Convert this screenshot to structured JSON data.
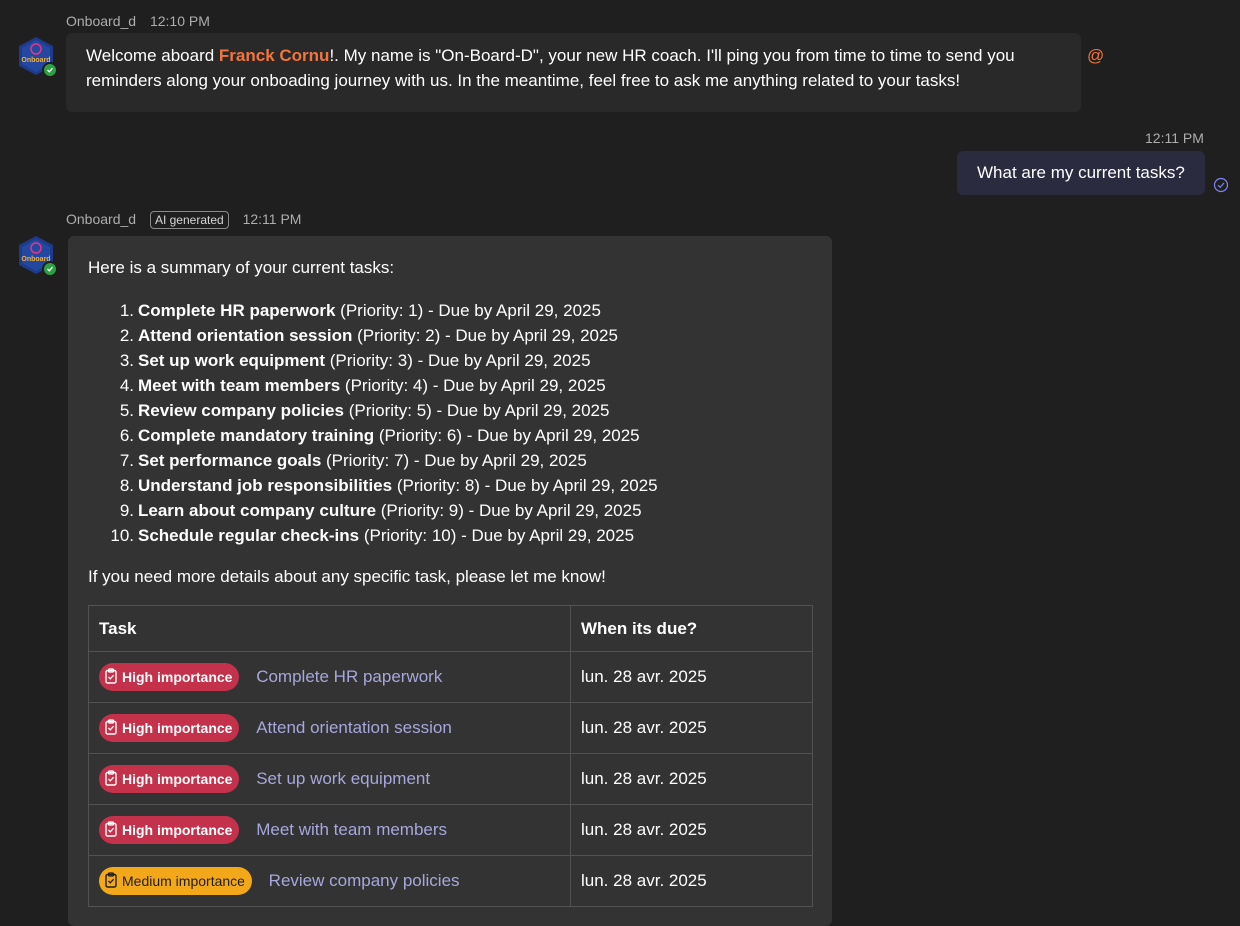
{
  "bot": {
    "name": "Onboard_d",
    "avatar_text": "Onboard_d"
  },
  "msg1": {
    "time": "12:10 PM",
    "text_before": "Welcome aboard ",
    "mention": "Franck Cornu",
    "text_after_line1": "!. My name is \"On-Board-D\", your new HR coach. I'll ping you from time to time to send you",
    "line2": "reminders along your onboading journey with us. In the meantime, feel free to ask me anything related to your tasks!",
    "at_symbol": "@"
  },
  "user_msg": {
    "time": "12:11 PM",
    "text": "What are my current tasks?"
  },
  "msg2": {
    "time": "12:11 PM",
    "ai_badge": "AI generated",
    "intro": "Here is a summary of your current tasks:",
    "tasks": [
      {
        "num": "1.",
        "title": "Complete HR paperwork",
        "rest": " (Priority: 1) - Due by April 29, 2025"
      },
      {
        "num": "2.",
        "title": "Attend orientation session",
        "rest": " (Priority: 2) - Due by April 29, 2025"
      },
      {
        "num": "3.",
        "title": "Set up work equipment",
        "rest": " (Priority: 3) - Due by April 29, 2025"
      },
      {
        "num": "4.",
        "title": "Meet with team members",
        "rest": " (Priority: 4) - Due by April 29, 2025"
      },
      {
        "num": "5.",
        "title": "Review company policies",
        "rest": " (Priority: 5) - Due by April 29, 2025"
      },
      {
        "num": "6.",
        "title": "Complete mandatory training",
        "rest": " (Priority: 6) - Due by April 29, 2025"
      },
      {
        "num": "7.",
        "title": "Set performance goals",
        "rest": " (Priority: 7) - Due by April 29, 2025"
      },
      {
        "num": "8.",
        "title": "Understand job responsibilities",
        "rest": " (Priority: 8) - Due by April 29, 2025"
      },
      {
        "num": "9.",
        "title": "Learn about company culture",
        "rest": " (Priority: 9) - Due by April 29, 2025"
      },
      {
        "num": "10.",
        "title": "Schedule regular check-ins",
        "rest": " (Priority: 10) - Due by April 29, 2025"
      }
    ],
    "outro": "If you need more details about any specific task, please let me know!",
    "table": {
      "col_task": "Task",
      "col_due": "When its due?",
      "rows": [
        {
          "badge": "High importance",
          "level": "high",
          "task": "Complete HR paperwork",
          "due": "lun. 28 avr. 2025"
        },
        {
          "badge": "High importance",
          "level": "high",
          "task": "Attend orientation session",
          "due": "lun. 28 avr. 2025"
        },
        {
          "badge": "High importance",
          "level": "high",
          "task": "Set up work equipment",
          "due": "lun. 28 avr. 2025"
        },
        {
          "badge": "High importance",
          "level": "high",
          "task": "Meet with team members",
          "due": "lun. 28 avr. 2025"
        },
        {
          "badge": "Medium importance",
          "level": "medium",
          "task": "Review company policies",
          "due": "lun. 28 avr. 2025"
        }
      ]
    }
  },
  "colors": {
    "background": "#1f1f1f",
    "bubble": "#292929",
    "card": "#333333",
    "user_bubble": "#2b2b40",
    "mention": "#f1753f",
    "link": "#a6a7dc",
    "high": "#c4314b",
    "medium": "#f3a81a"
  }
}
